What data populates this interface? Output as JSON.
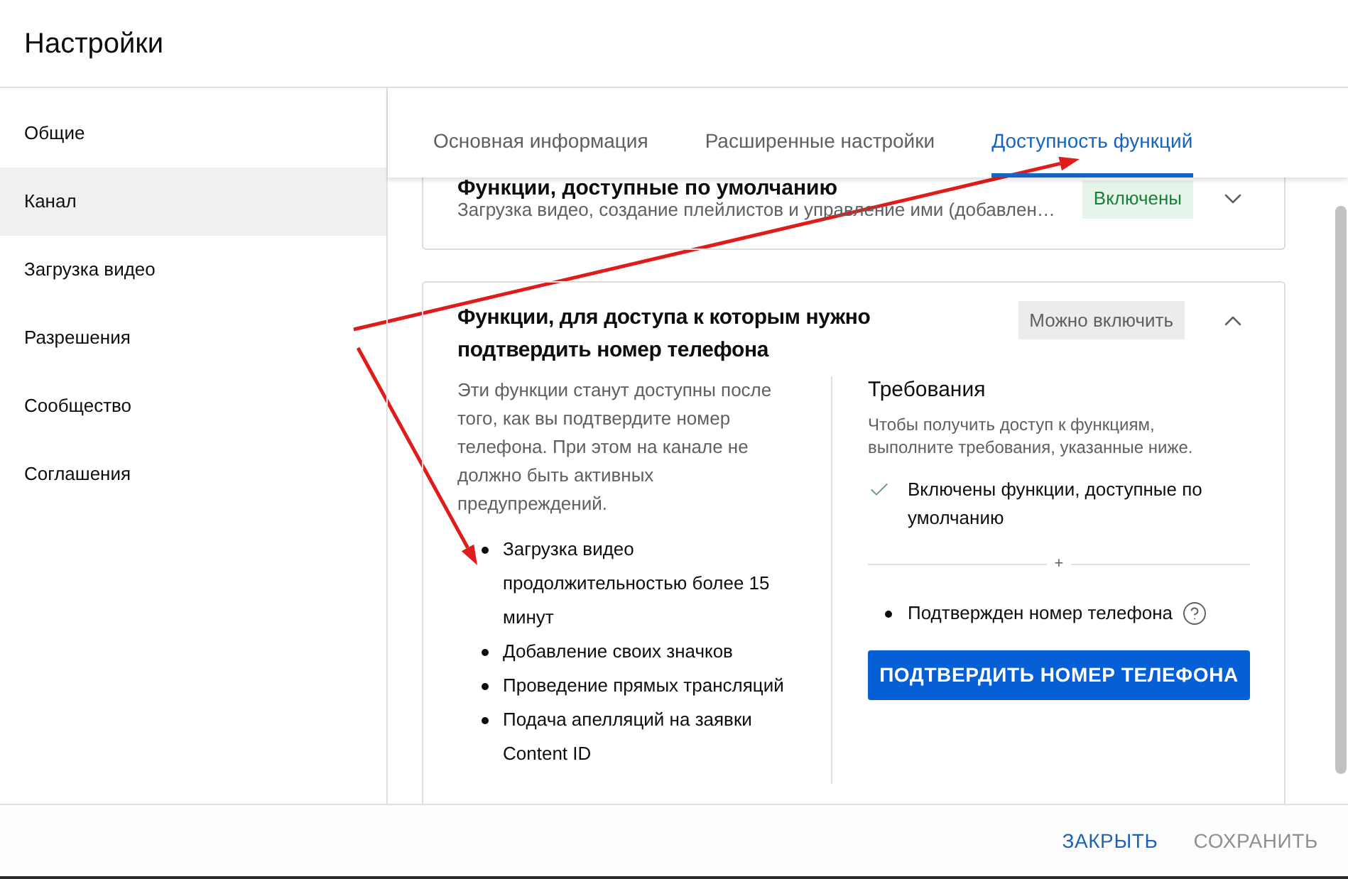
{
  "window": {
    "title": "Настройки"
  },
  "sidebar": {
    "items": [
      {
        "label": "Общие",
        "selected": false
      },
      {
        "label": "Канал",
        "selected": true
      },
      {
        "label": "Загрузка видео",
        "selected": false
      },
      {
        "label": "Разрешения",
        "selected": false
      },
      {
        "label": "Сообщество",
        "selected": false
      },
      {
        "label": "Соглашения",
        "selected": false
      }
    ]
  },
  "tabs": [
    {
      "label": "Основная информация",
      "selected": false
    },
    {
      "label": "Расширенные настройки",
      "selected": false
    },
    {
      "label": "Доступность функций",
      "selected": true
    }
  ],
  "cards": [
    {
      "title": "Функции, доступные по умолчанию",
      "subtitle": "Загрузка видео, создание плейлистов и управление ими (добавлен…",
      "status": {
        "label": "Включены",
        "kind": "enabled"
      },
      "expanded": false
    },
    {
      "title": "Функции, для доступа к которым нужно подтвердить номер телефона",
      "status": {
        "label": "Можно включить",
        "kind": "available"
      },
      "expanded": true,
      "description": "Эти функции станут доступны после того, как вы подтвердите номер телефона. При этом на канале не должно быть активных предупреждений.",
      "features": [
        "Загрузка видео продолжительностью более 15 минут",
        "Добавление своих значков",
        "Проведение прямых трансляций",
        "Подача апелляций на заявки Content ID"
      ],
      "requirements": {
        "title": "Требования",
        "description": "Чтобы получить доступ к функциям, выполните требования, указанные ниже.",
        "items": [
          {
            "label": "Включены функции, доступные по умолчанию",
            "met": true,
            "help": false
          },
          {
            "label": "Подтвержден номер телефона",
            "met": false,
            "help": true
          }
        ],
        "joiner": "+",
        "button": "ПОДТВЕРДИТЬ НОМЕР ТЕЛЕФОНА"
      }
    }
  ],
  "footer": {
    "buttons": [
      {
        "label": "ЗАКРЫТЬ",
        "disabled": false
      },
      {
        "label": "СОХРАНИТЬ",
        "disabled": true
      }
    ]
  },
  "annotations": [
    {
      "kind": "arrow"
    },
    {
      "kind": "arrow"
    }
  ]
}
